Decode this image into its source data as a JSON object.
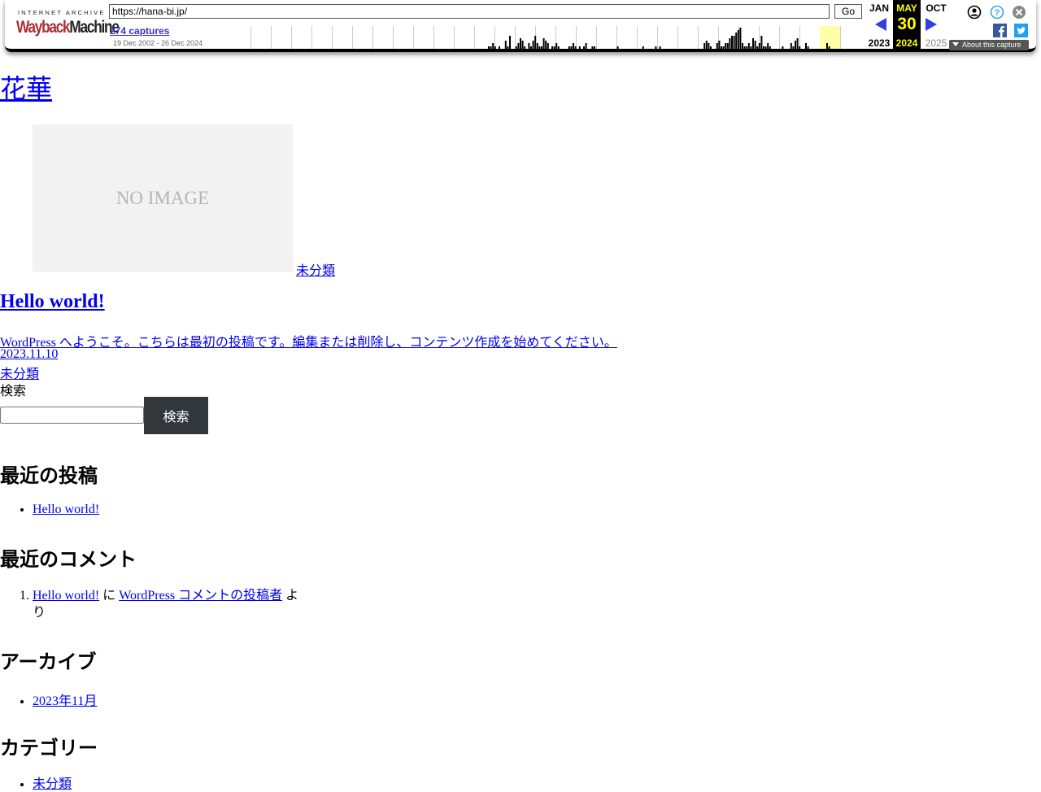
{
  "wayback": {
    "logo_top": "INTERNET ARCHIVE",
    "logo_wayback_a": "Wayback",
    "logo_wayback_b": "Machine",
    "url": "https://hana-bi.jp/",
    "go_label": "Go",
    "captures_label": "274 captures",
    "date_range": "19 Dec 2002 - 26 Dec 2024",
    "prev_month": "JAN",
    "prev_year": "2023",
    "current_month": "MAY",
    "current_day": "30",
    "current_year": "2024",
    "next_month": "OCT",
    "next_year": "2025",
    "about_label": "About this capture",
    "sparkline_capture_counts": [
      0,
      0,
      0,
      0,
      0,
      0,
      0,
      0,
      0,
      0,
      0,
      0,
      0,
      0,
      0,
      0,
      0,
      0,
      0,
      0,
      0,
      0,
      0,
      0,
      0,
      0,
      0,
      0,
      0,
      0,
      0,
      0,
      0,
      0,
      0,
      0,
      0,
      0,
      0,
      0,
      0,
      0,
      0,
      0,
      0,
      1,
      1,
      2,
      1,
      0,
      1,
      0,
      0,
      3,
      1,
      5,
      0,
      0,
      1,
      2,
      4,
      3,
      1,
      0,
      2,
      1,
      3,
      5,
      2,
      1,
      1,
      4,
      3,
      2,
      0,
      1,
      1,
      2,
      1,
      0,
      0,
      0,
      0,
      1,
      1,
      2,
      1,
      0,
      1,
      0,
      1,
      2,
      0,
      0,
      1,
      1,
      0,
      0,
      0,
      0,
      0,
      0,
      0,
      0,
      0,
      0,
      1,
      0,
      0,
      0,
      0,
      0,
      0,
      0,
      0,
      0,
      0,
      0,
      1,
      0,
      0,
      0,
      0,
      0,
      1,
      0,
      1,
      0,
      0,
      0,
      0,
      0,
      0,
      0,
      0,
      0,
      0,
      0,
      0,
      0,
      0,
      0,
      0,
      0,
      0,
      0,
      0,
      2,
      3,
      2,
      1,
      0,
      0,
      2,
      3,
      1,
      1,
      2,
      2,
      4,
      5,
      5,
      6,
      7,
      8,
      2,
      1,
      1,
      2,
      1,
      4,
      3,
      1,
      2,
      5,
      1,
      1,
      2,
      1,
      0,
      0,
      0,
      0,
      0,
      1,
      0,
      0,
      0,
      2,
      1,
      3,
      4,
      1,
      0,
      0,
      2,
      1,
      0,
      0,
      0,
      0,
      0,
      0,
      0,
      0,
      2,
      1,
      0,
      0,
      0,
      0,
      0,
      0
    ]
  },
  "site": {
    "title": "花華"
  },
  "post": {
    "thumbnail_text": "NO IMAGE",
    "thumbnail_category": "未分類",
    "title": "Hello world!",
    "excerpt": "WordPress へようこそ。こちらは最初の投稿です。編集または削除し、コンテンツ作成を始めてください。",
    "date": "2023.11.10",
    "category": "未分類"
  },
  "search": {
    "label": "検索",
    "button_label": "検索",
    "value": ""
  },
  "widgets": {
    "recent_posts": {
      "title": "最近の投稿",
      "items": [
        "Hello world!"
      ]
    },
    "recent_comments": {
      "title": "最近のコメント",
      "post_link": "Hello world!",
      "connector_ni": " に ",
      "author_link": "WordPress コメントの投稿者",
      "connector_yori": " より"
    },
    "archive": {
      "title": "アーカイブ",
      "items": [
        "2023年11月"
      ]
    },
    "categories": {
      "title": "カテゴリー",
      "items": [
        "未分類"
      ]
    }
  }
}
